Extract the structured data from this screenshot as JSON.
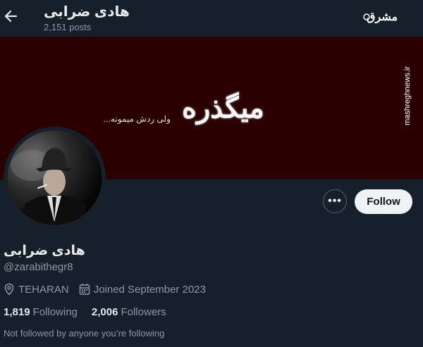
{
  "header": {
    "title": "هادی ضرابی",
    "posts": "2,151 posts"
  },
  "banner": {
    "main_text": "میگذره",
    "sub_text": "ولی ردش میمونه..."
  },
  "watermark": {
    "logo_text": "مشرق",
    "url_text": "mashreghnews.ir"
  },
  "profile": {
    "name": "هادی ضرابی",
    "handle": "@zarabithegr8",
    "location": "TEHARAN",
    "joined": "Joined September 2023",
    "following_count": "1,819",
    "following_label": "Following",
    "followers_count": "2,006",
    "followers_label": "Followers",
    "not_followed": "Not followed by anyone you’re following"
  },
  "actions": {
    "more_label": "•••",
    "follow_label": "Follow"
  },
  "colors": {
    "background": "#15202b",
    "banner": "#2a0000",
    "secondary_text": "#8b98a5",
    "follow_button": "#eff3f4"
  }
}
